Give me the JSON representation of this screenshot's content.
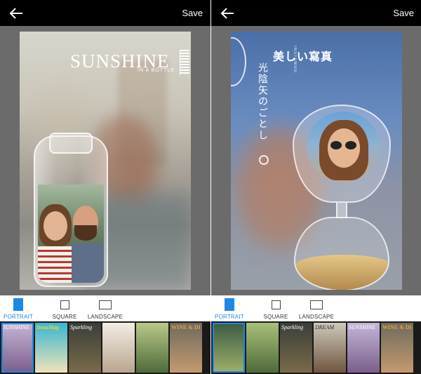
{
  "panels": [
    {
      "id": "left",
      "toolbar": {
        "back_label": "",
        "save_label": "Save"
      },
      "poster": {
        "title": "SUNSHINE",
        "subtitle": "IN A BOTTLE"
      },
      "orientation": {
        "selected": "PORTRAIT",
        "options": [
          {
            "label": "PORTRAIT",
            "icon": "portrait-icon"
          },
          {
            "label": "SQUARE",
            "icon": "square-icon"
          },
          {
            "label": "LANDSCAPE",
            "icon": "landscape-icon"
          }
        ]
      },
      "templates": [
        {
          "label": "SUNSHINE",
          "bg": [
            "#c5b6d8",
            "#7a5f8a"
          ],
          "style": ""
        },
        {
          "label": "InstaMag",
          "bg": [
            "#38b6cf",
            "#f0e3b8"
          ],
          "style": "yellow"
        },
        {
          "label": "Sparkling",
          "bg": [
            "#3a3f3a",
            "#7a6a4a"
          ],
          "style": ""
        },
        {
          "label": "",
          "bg": [
            "#f3ede4",
            "#b9a58f"
          ],
          "style": "dark"
        },
        {
          "label": "",
          "bg": [
            "#b9c98a",
            "#4f6a3a"
          ],
          "style": ""
        },
        {
          "label": "WINE & DINE",
          "bg": [
            "#6e6a5f",
            "#c59a6e"
          ],
          "style": "orange"
        }
      ]
    },
    {
      "id": "right",
      "toolbar": {
        "back_label": "",
        "save_label": "Save"
      },
      "poster": {
        "title": "美しい寫真",
        "vertical_text": "光陰矢のごとし",
        "brand": "INSTAMAG"
      },
      "orientation": {
        "selected": "PORTRAIT",
        "options": [
          {
            "label": "PORTRAIT",
            "icon": "portrait-icon"
          },
          {
            "label": "SQUARE",
            "icon": "square-icon"
          },
          {
            "label": "LANDSCAPE",
            "icon": "landscape-icon"
          }
        ]
      },
      "templates": [
        {
          "label": "",
          "bg": [
            "#3b5b44",
            "#9fb06a"
          ],
          "style": ""
        },
        {
          "label": "",
          "bg": [
            "#a9c07a",
            "#4f6a3a"
          ],
          "style": ""
        },
        {
          "label": "Sparkling",
          "bg": [
            "#3a3f3a",
            "#7a6a4a"
          ],
          "style": ""
        },
        {
          "label": "DREAM",
          "bg": [
            "#cfc8bb",
            "#6f5640"
          ],
          "style": "dark"
        },
        {
          "label": "SUNSHINE",
          "bg": [
            "#c5b6d8",
            "#7a5f8a"
          ],
          "style": ""
        },
        {
          "label": "WINE & DINE",
          "bg": [
            "#6e6a5f",
            "#c59a6e"
          ],
          "style": "orange"
        }
      ]
    }
  ],
  "colors": {
    "accent": "#1e88e5",
    "toolbar_bg": "#000000",
    "canvas_bg": "#6b6b6b",
    "strip_bg": "#1a1a1a"
  }
}
